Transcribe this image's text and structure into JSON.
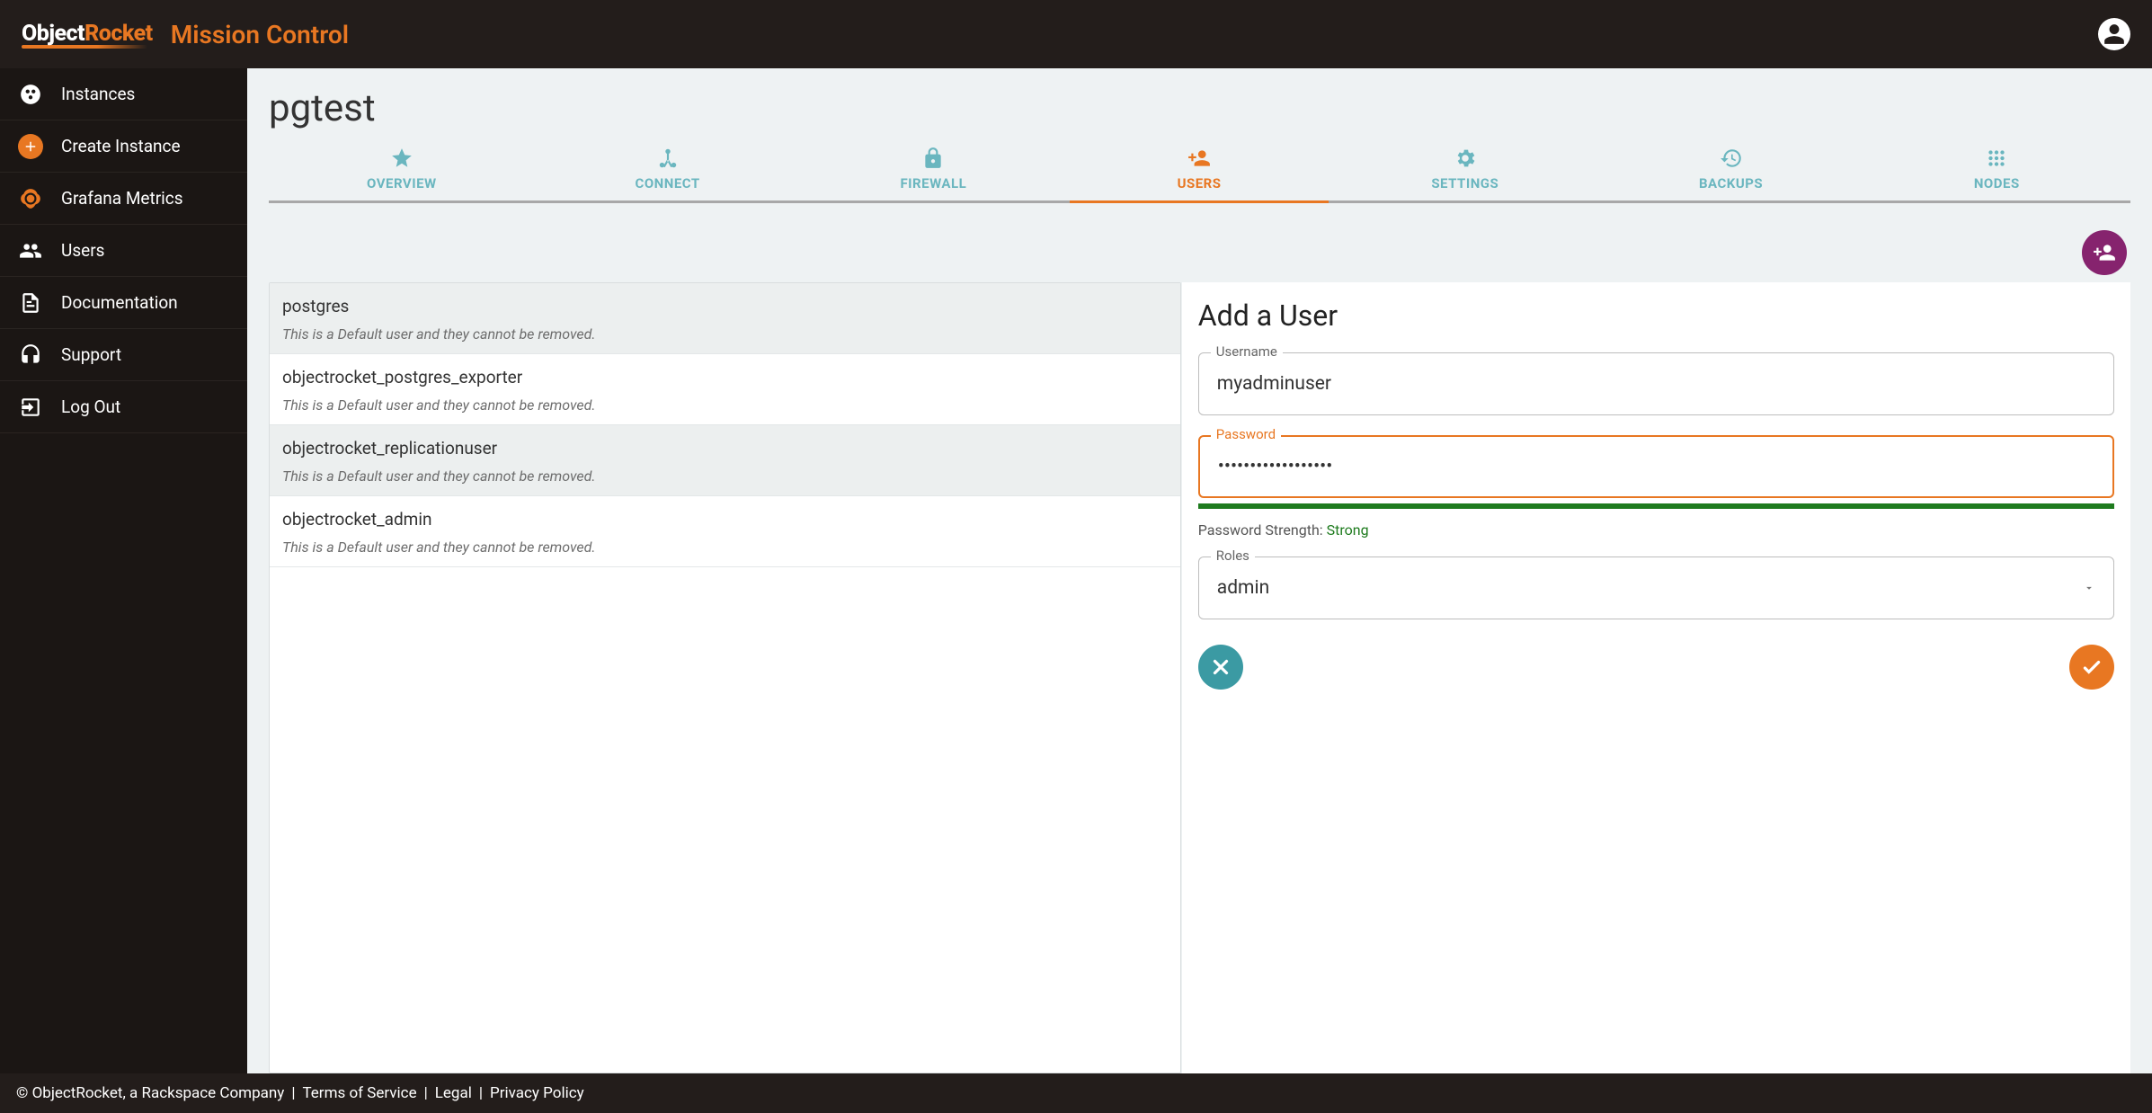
{
  "header": {
    "logo_prefix": "Object",
    "logo_suffix": "Rocket",
    "app_name": "Mission Control"
  },
  "sidebar": {
    "items": [
      {
        "label": "Instances"
      },
      {
        "label": "Create Instance"
      },
      {
        "label": "Grafana Metrics"
      },
      {
        "label": "Users"
      },
      {
        "label": "Documentation"
      },
      {
        "label": "Support"
      },
      {
        "label": "Log Out"
      }
    ]
  },
  "page": {
    "title": "pgtest",
    "tabs": [
      {
        "label": "OVERVIEW"
      },
      {
        "label": "CONNECT"
      },
      {
        "label": "FIREWALL"
      },
      {
        "label": "USERS"
      },
      {
        "label": "SETTINGS"
      },
      {
        "label": "BACKUPS"
      },
      {
        "label": "NODES"
      }
    ],
    "active_tab": "USERS"
  },
  "users": [
    {
      "name": "postgres",
      "note": "This is a Default user and they cannot be removed."
    },
    {
      "name": "objectrocket_postgres_exporter",
      "note": "This is a Default user and they cannot be removed."
    },
    {
      "name": "objectrocket_replicationuser",
      "note": "This is a Default user and they cannot be removed."
    },
    {
      "name": "objectrocket_admin",
      "note": "This is a Default user and they cannot be removed."
    }
  ],
  "form": {
    "title": "Add a User",
    "username_label": "Username",
    "username_value": "myadminuser",
    "password_label": "Password",
    "password_value": "••••••••••••••••••",
    "strength_label": "Password Strength: ",
    "strength_value": "Strong",
    "roles_label": "Roles",
    "roles_value": "admin"
  },
  "footer": {
    "copyright": "© ObjectRocket, a Rackspace Company",
    "links": [
      "Terms of Service",
      "Legal",
      "Privacy Policy"
    ],
    "sep": " | "
  }
}
